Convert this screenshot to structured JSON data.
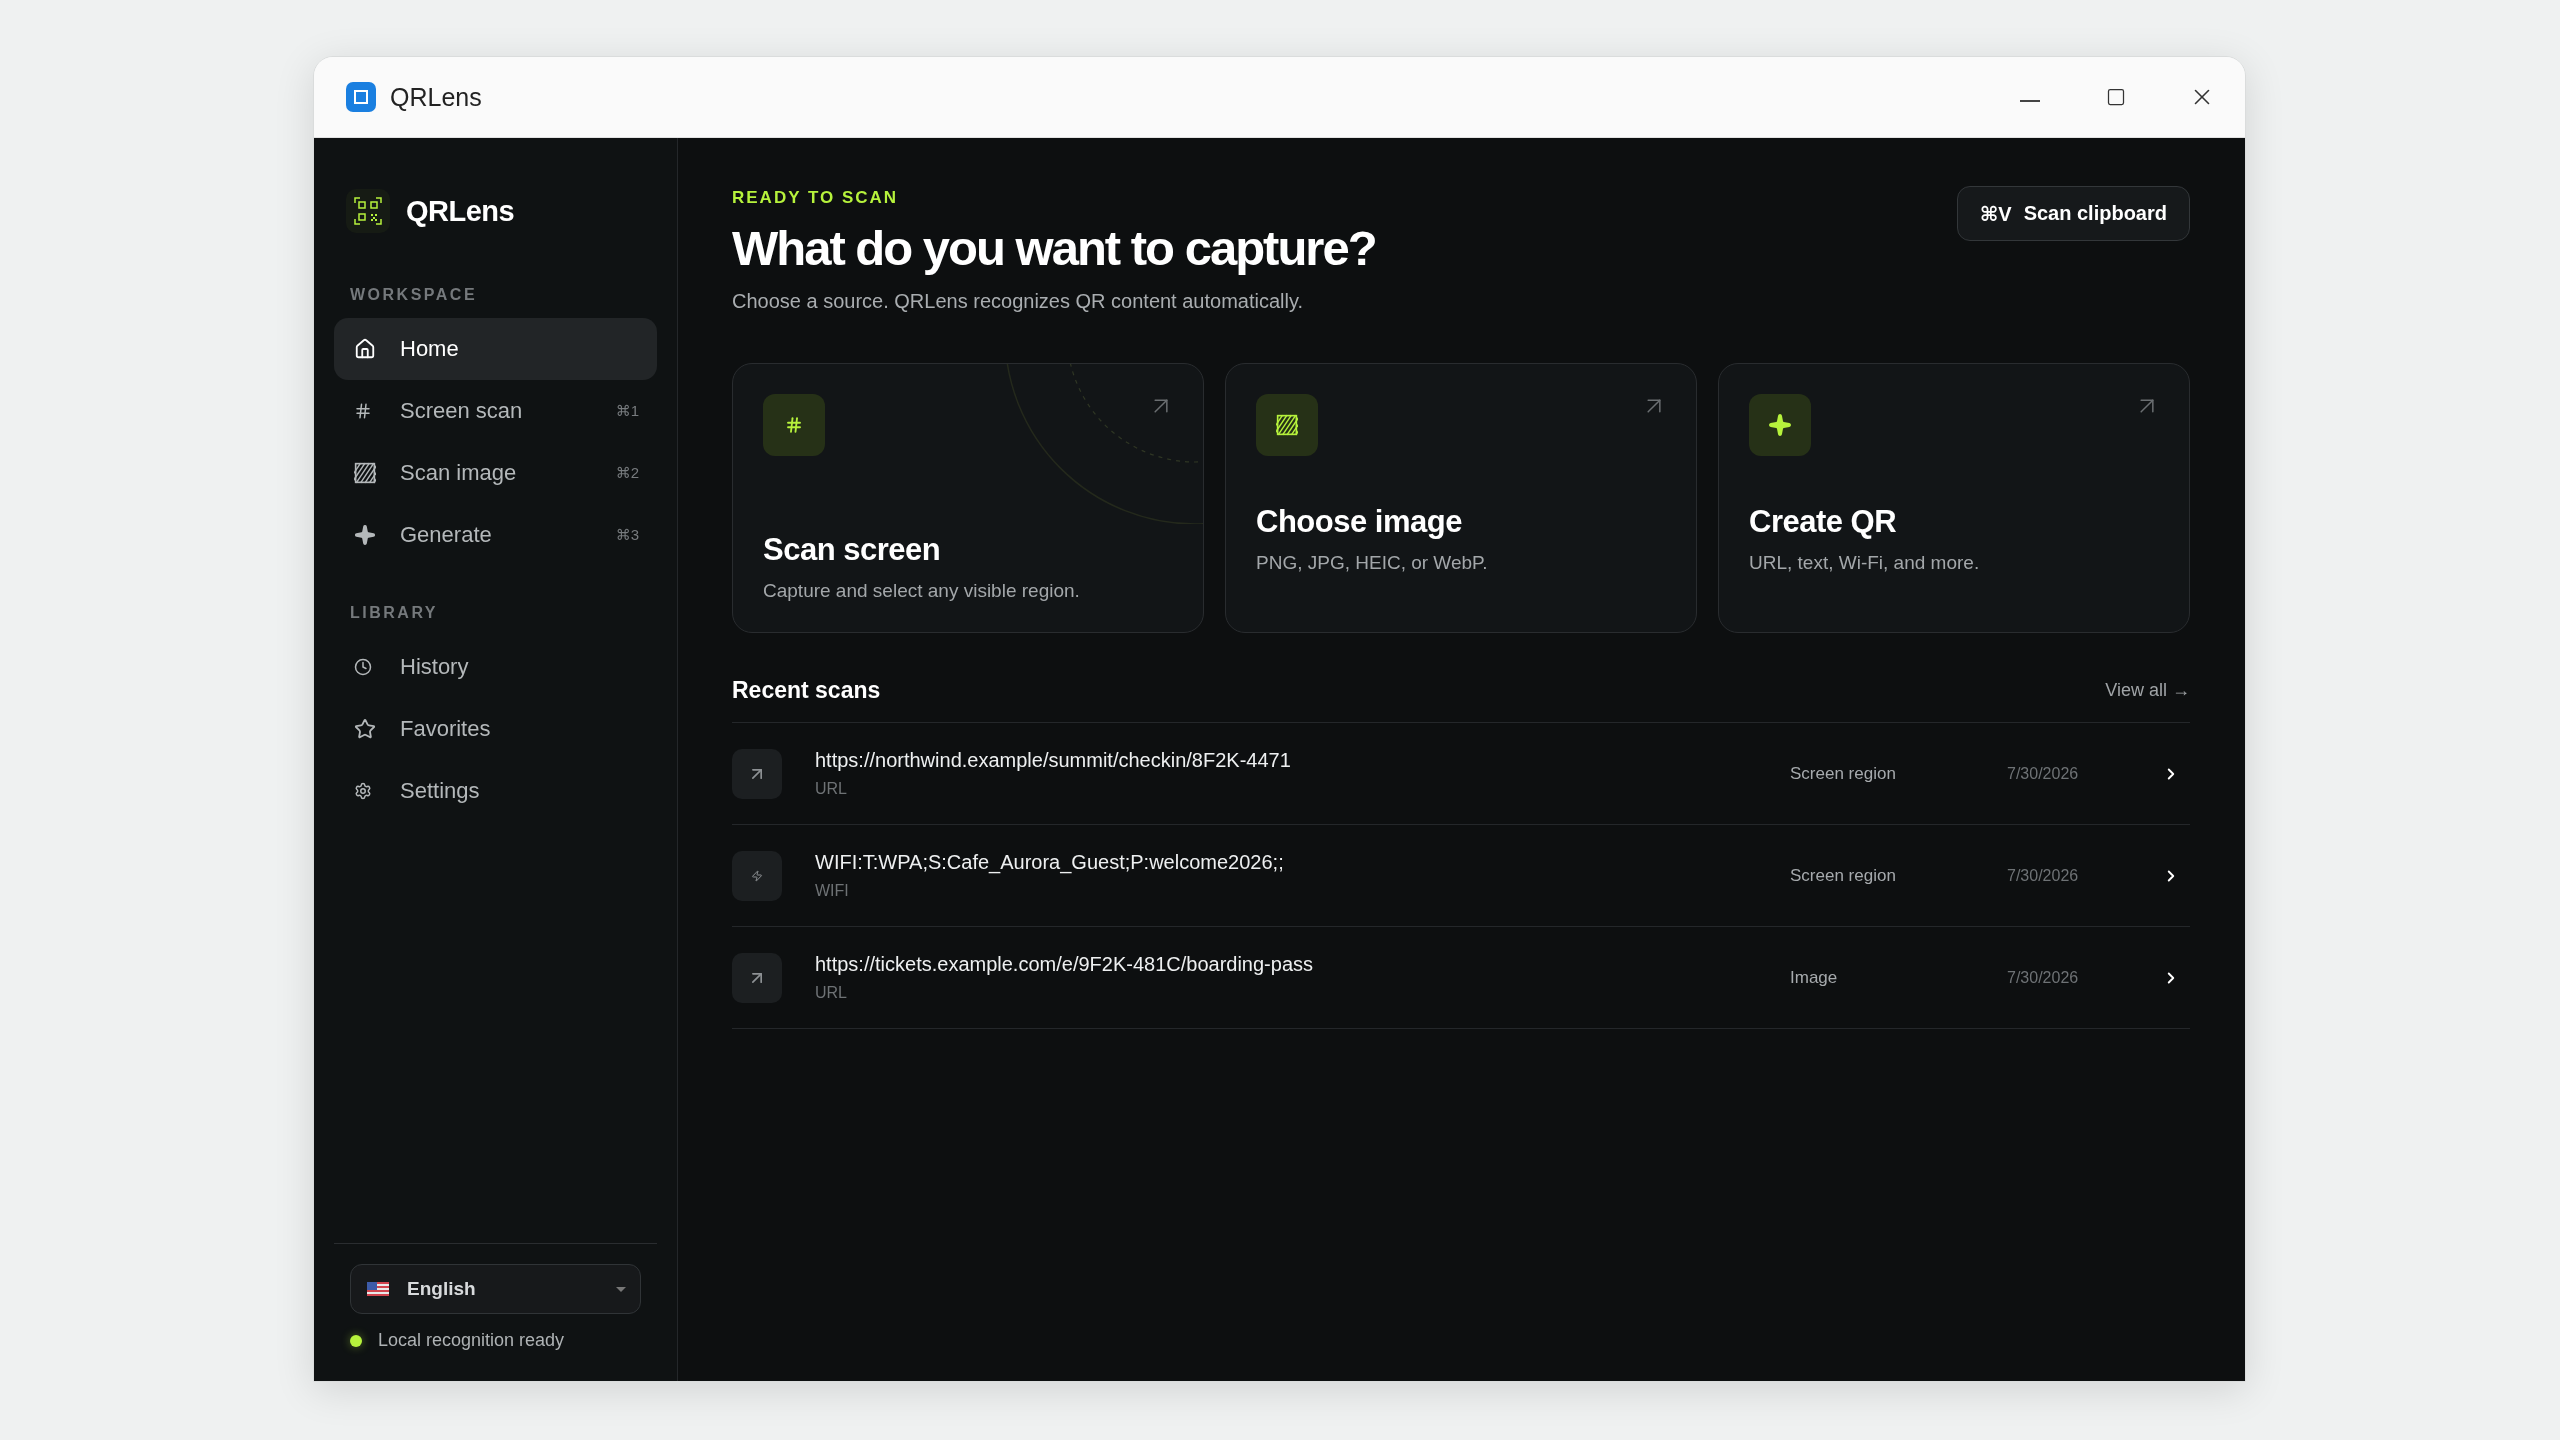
{
  "window": {
    "title": "QRLens"
  },
  "sidebar": {
    "brand": "QRLens",
    "sections": [
      {
        "label": "WORKSPACE",
        "items": [
          {
            "kind": "home",
            "label": "Home",
            "selected": true
          },
          {
            "kind": "grid",
            "label": "Screen scan",
            "shortcut": "⌘1",
            "selected": false
          },
          {
            "kind": "image",
            "label": "Scan image",
            "shortcut": "⌘2",
            "selected": false
          },
          {
            "kind": "sparkle",
            "label": "Generate",
            "shortcut": "⌘3",
            "selected": false
          }
        ]
      },
      {
        "label": "LIBRARY",
        "items": [
          {
            "kind": "clock",
            "label": "History",
            "selected": false
          },
          {
            "kind": "star",
            "label": "Favorites",
            "selected": false
          },
          {
            "kind": "gear",
            "label": "Settings",
            "selected": false
          }
        ]
      }
    ],
    "language": {
      "value": "English"
    },
    "status": {
      "text": "Local recognition ready"
    }
  },
  "header": {
    "eyebrow": "READY TO SCAN",
    "title": "What do you want to capture?",
    "subtitle": "Choose a source. QRLens recognizes QR content automatically.",
    "clipboard_button": {
      "shortcut": "⌘V",
      "label": "Scan clipboard"
    }
  },
  "cards": [
    {
      "kind": "grid",
      "title": "Scan screen",
      "description": "Capture and select any visible region."
    },
    {
      "kind": "image",
      "title": "Choose image",
      "description": "PNG, JPG, HEIC, or WebP."
    },
    {
      "kind": "sparkle",
      "title": "Create QR",
      "description": "URL, text, Wi-Fi, and more."
    }
  ],
  "recent": {
    "title": "Recent scans",
    "view_all": "View all →",
    "rows": [
      {
        "kind": "link",
        "content": "https://northwind.example/summit/checkin/8F2K-4471",
        "type": "URL",
        "source": "Screen region",
        "date": "7/30/2026"
      },
      {
        "kind": "wifi",
        "content": "WIFI:T:WPA;S:Cafe_Aurora_Guest;P:welcome2026;;",
        "type": "WIFI",
        "source": "Screen region",
        "date": "7/30/2026"
      },
      {
        "kind": "link",
        "content": "https://tickets.example.com/e/9F2K-481C/boarding-pass",
        "type": "URL",
        "source": "Image",
        "date": "7/30/2026"
      }
    ]
  }
}
